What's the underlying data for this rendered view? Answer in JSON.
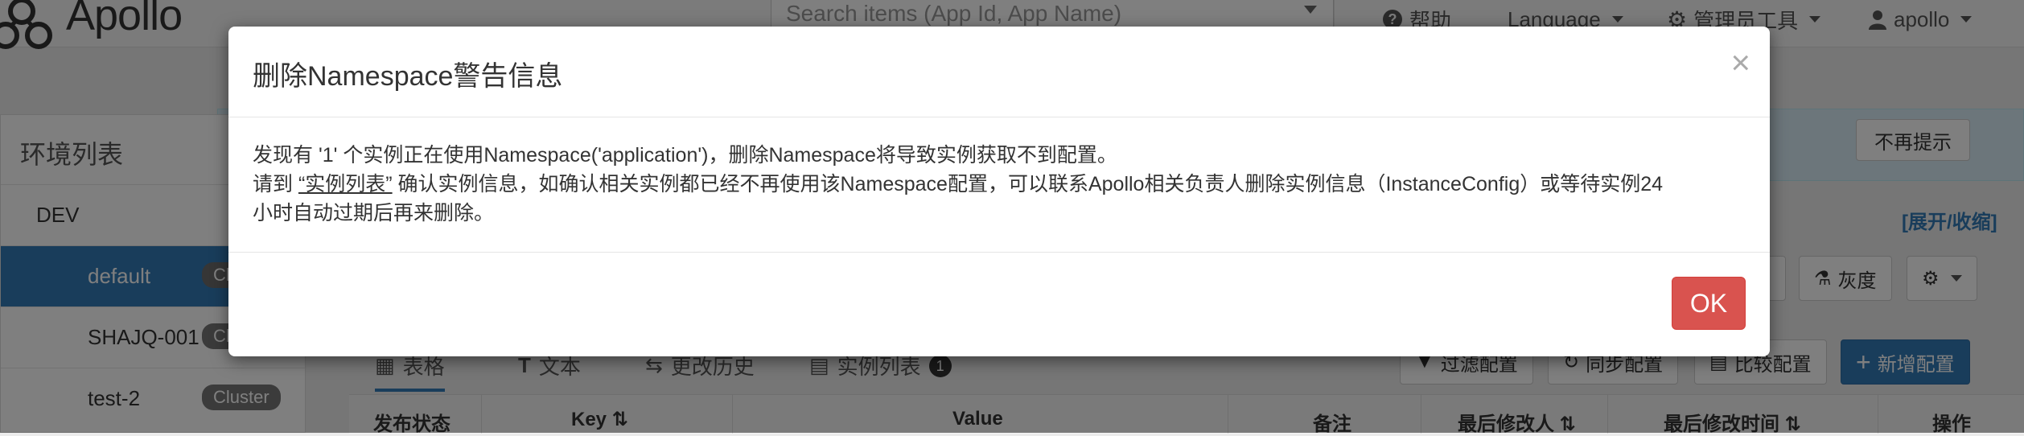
{
  "navbar": {
    "logo_text": "Apollo",
    "search_placeholder": "Search items (App Id, App Name)",
    "help": "帮助",
    "language": "Language",
    "admin_tools": "管理员工具",
    "user": "apollo"
  },
  "banner": {
    "no_remind_button": "不再提示"
  },
  "sidebar": {
    "title": "环境列表",
    "env": "DEV",
    "clusters": [
      {
        "name": "default",
        "badge": "Cl",
        "active": true
      },
      {
        "name": "SHAJQ-001",
        "badge": "Cl"
      },
      {
        "name": "test-2",
        "badge": "Cluster"
      }
    ]
  },
  "expand_collapse": "[展开/收缩]",
  "toolbar": {
    "gray": "灰度",
    "filter": "过滤配置",
    "sync": "同步配置",
    "compare": "比较配置",
    "add": "新增配置"
  },
  "tabs": [
    {
      "label": "表格",
      "active": true
    },
    {
      "label": "文本"
    },
    {
      "label": "更改历史"
    },
    {
      "label": "实例列表",
      "badge": "1"
    }
  ],
  "table_headers": [
    "发布状态",
    "Key",
    "Value",
    "备注",
    "最后修改人",
    "最后修改时间",
    "操作"
  ],
  "modal": {
    "title": "删除Namespace警告信息",
    "close": "×",
    "line1": "发现有 '1' 个实例正在使用Namespace('application')，删除Namespace将导致实例获取不到配置。",
    "line2_prefix": "请到 ",
    "line2_link": "“实例列表”",
    "line2_suffix": " 确认实例信息，如确认相关实例都已经不再使用该Namespace配置，可以联系Apollo相关负责人删除实例信息（InstanceConfig）或等待实例24",
    "line3": "小时自动过期后再来删除。",
    "ok": "OK"
  }
}
